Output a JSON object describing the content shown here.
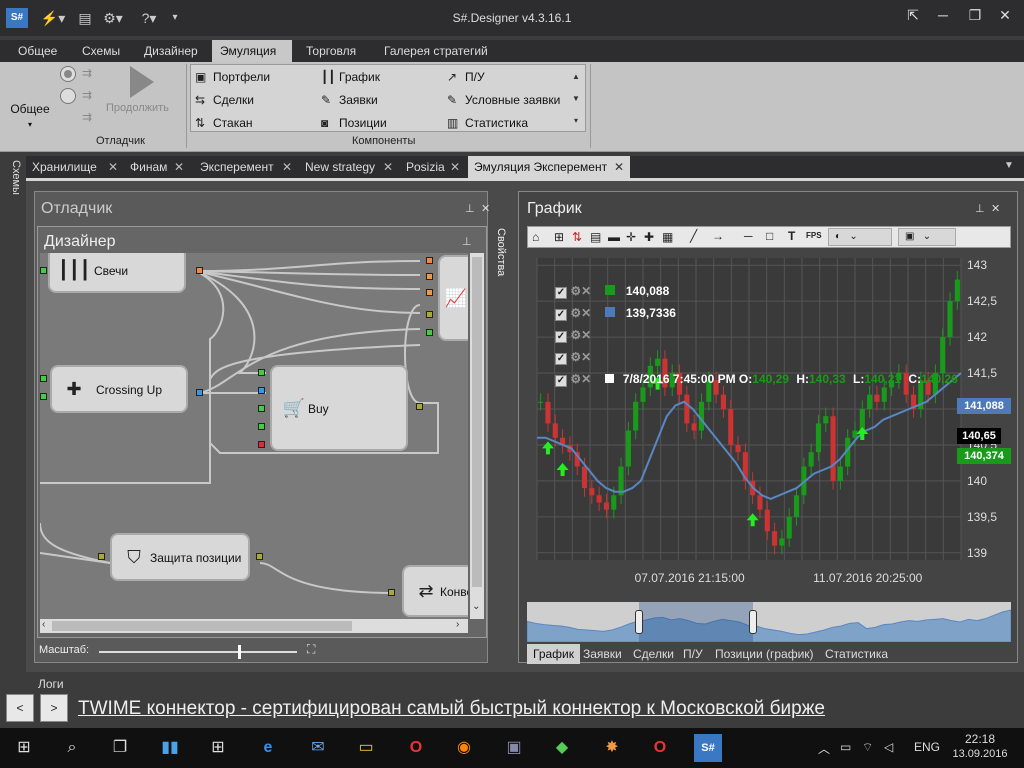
{
  "window": {
    "title": "S#.Designer v4.3.16.1",
    "app_icon": "S#"
  },
  "menu": {
    "tabs": [
      "Общее",
      "Схемы",
      "Дизайнер",
      "Эмуляция",
      "Торговля",
      "Галерея стратегий"
    ],
    "active_index": 3
  },
  "ribbon": {
    "general_label": "Общее",
    "continue_label": "Продолжить",
    "debugger_group": "Отладчик",
    "components_group": "Компоненты",
    "components": [
      {
        "label": "Портфели",
        "icon": "portfolio-icon"
      },
      {
        "label": "Сделки",
        "icon": "trades-icon"
      },
      {
        "label": "Стакан",
        "icon": "orderbook-icon"
      },
      {
        "label": "График",
        "icon": "chart-icon"
      },
      {
        "label": "Заявки",
        "icon": "orders-icon"
      },
      {
        "label": "Позиции",
        "icon": "positions-icon"
      },
      {
        "label": "П/У",
        "icon": "pnl-icon"
      },
      {
        "label": "Условные заявки",
        "icon": "conditional-orders-icon"
      },
      {
        "label": "Статистика",
        "icon": "statistics-icon"
      }
    ]
  },
  "left_vertical_tab": "Схемы",
  "doc_tabs": [
    {
      "label": "Хранилище",
      "active": false
    },
    {
      "label": "Финам",
      "active": false
    },
    {
      "label": "Эксперемент",
      "active": false
    },
    {
      "label": "New strategy",
      "active": false
    },
    {
      "label": "Posizia",
      "active": false
    },
    {
      "label": "Эмуляция Эксперемент",
      "active": true
    }
  ],
  "debugger_panel": {
    "title": "Отладчик",
    "designer_title": "Дизайнер",
    "properties_label": "Свойства",
    "scale_label": "Масштаб:",
    "scale_value": 0.7,
    "nodes": [
      {
        "label": "Свечи",
        "icon": "candles-icon"
      },
      {
        "label": "Crossing Up",
        "icon": "puzzle-icon"
      },
      {
        "label": "Buy",
        "icon": "buy-cart-icon"
      },
      {
        "label": "Защита позиции",
        "icon": "shield-icon"
      },
      {
        "label": "Конве",
        "icon": "convert-arrows-icon"
      },
      {
        "label": "",
        "icon": "chart-icon"
      }
    ]
  },
  "chart_panel": {
    "title": "График",
    "tabs": [
      "График",
      "Заявки",
      "Сделки",
      "П/У",
      "Позиции (график)",
      "Статистика"
    ],
    "active_tab": 0,
    "legend": [
      {
        "value": "140,088",
        "color": "#1a9a1a"
      },
      {
        "value": "139,7336",
        "color": "#4d7ab8"
      },
      {
        "value": ""
      },
      {
        "value": ""
      },
      {
        "value": "7/8/2016 7:45:00 PM O:",
        "ohlc": [
          "O:",
          "H:",
          "L:",
          "C:"
        ],
        "ohlc_values": [
          "140,29",
          "140,33",
          "140,21",
          "140,26"
        ],
        "color": "#ffffff"
      }
    ],
    "price_badges": {
      "blue": "141,088",
      "black": "140,65",
      "green": "140,374"
    }
  },
  "chart_data": {
    "type": "line",
    "x_ticks": [
      "07.07.2016 21:15:00",
      "11.07.2016 20:25:00"
    ],
    "y_ticks": [
      139,
      139.5,
      140,
      140.5,
      141,
      141.5,
      142,
      142.5,
      143
    ],
    "ylim": [
      138.9,
      143.1
    ],
    "series": [
      {
        "name": "",
        "type": "candles",
        "values": [
          141.1,
          140.8,
          140.6,
          140.5,
          140.4,
          140.2,
          139.9,
          139.8,
          139.7,
          139.6,
          139.8,
          140.2,
          140.7,
          141.1,
          141.3,
          141.6,
          141.7,
          141.3,
          141.5,
          141.2,
          140.8,
          140.7,
          141.1,
          141.4,
          141.2,
          141.0,
          140.5,
          140.4,
          140.0,
          139.8,
          139.6,
          139.3,
          139.1,
          139.2,
          139.5,
          139.8,
          140.2,
          140.4,
          140.8,
          140.9,
          140.0,
          140.2,
          140.6,
          140.7,
          141.0,
          141.2,
          141.1,
          141.3,
          141.4,
          141.5,
          141.2,
          141.0,
          141.4,
          141.2,
          141.5,
          142.0,
          142.5,
          142.8
        ]
      },
      {
        "name": "",
        "type": "sma",
        "values": [
          140.6,
          140.6,
          140.55,
          140.5,
          140.45,
          140.3,
          140.15,
          140.0,
          139.9,
          139.85,
          139.85,
          139.9,
          140.0,
          140.3,
          140.6,
          140.9,
          141.05,
          141.1,
          141.0,
          140.85,
          140.7,
          140.55,
          140.4,
          140.25,
          140.05,
          139.9,
          139.8,
          139.75,
          139.8,
          139.85,
          139.9,
          140.0,
          140.1,
          140.15,
          140.2,
          140.3,
          140.45,
          140.6,
          140.7,
          140.75,
          140.85,
          140.9,
          140.95,
          141.0,
          141.05,
          141.1,
          141.2,
          141.3,
          141.4,
          141.5
        ]
      },
      {
        "name": "",
        "type": "buy-signals",
        "x_index": [
          1,
          3,
          16,
          29,
          44
        ]
      }
    ],
    "grid": true
  }
}
